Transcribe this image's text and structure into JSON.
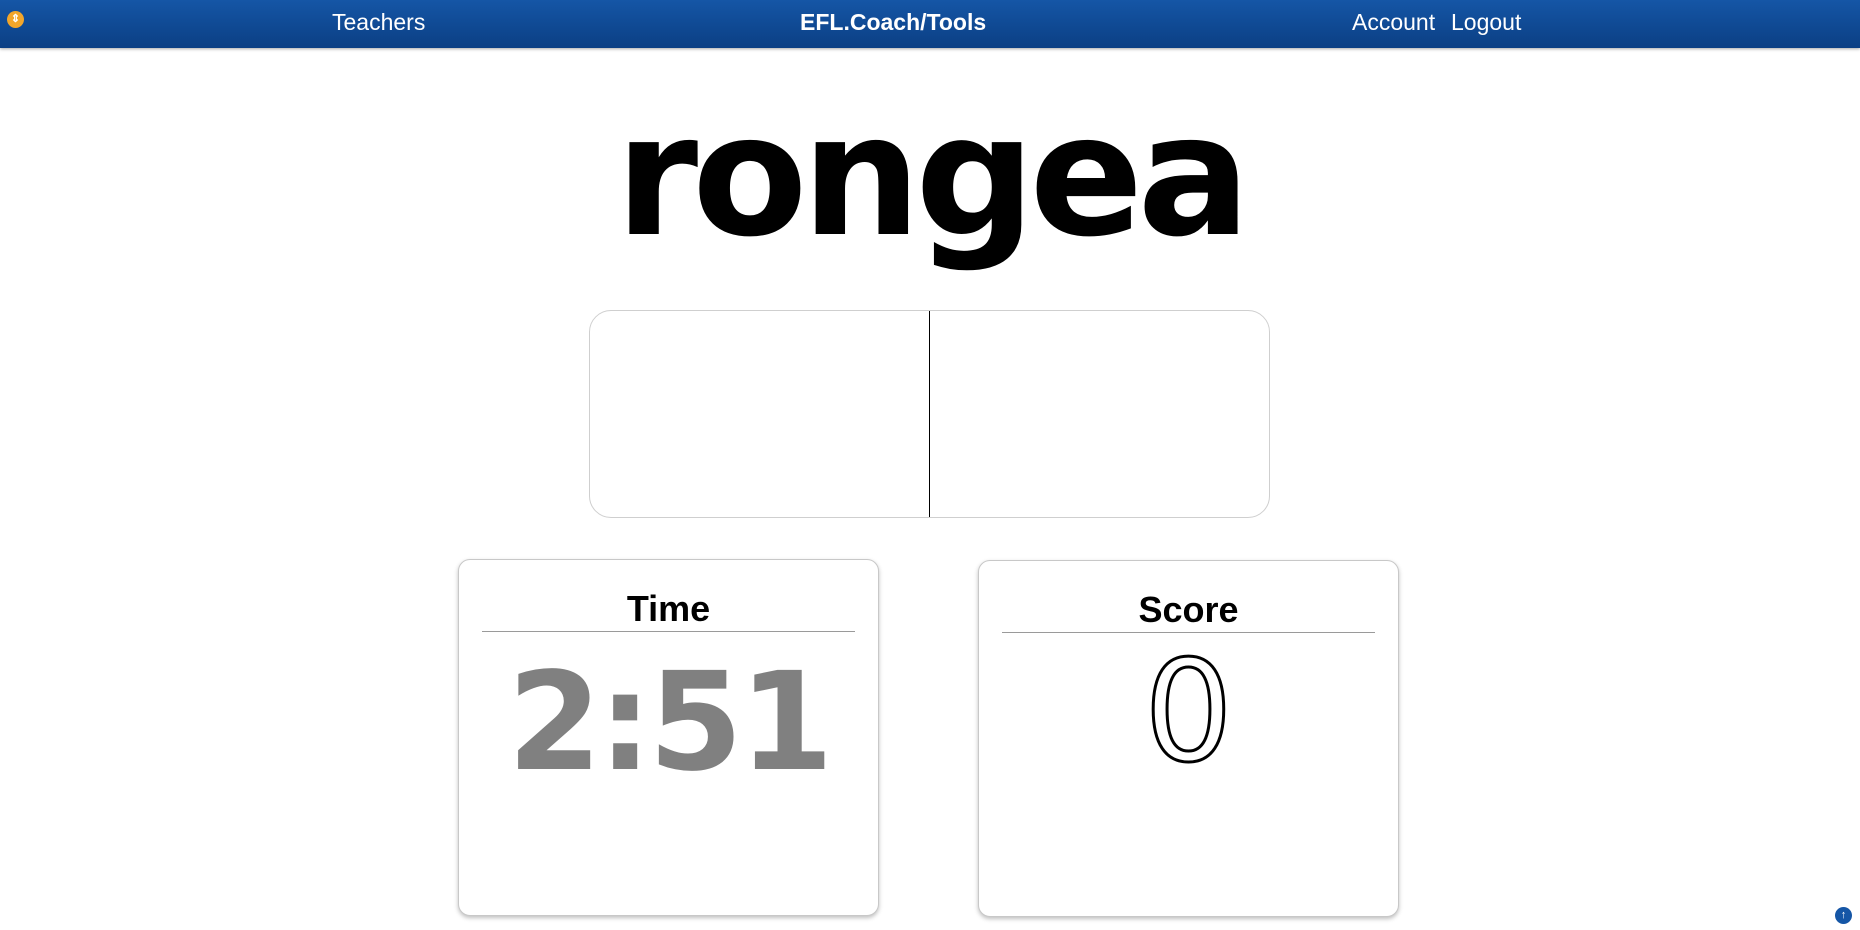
{
  "nav": {
    "teachers_label": "Teachers",
    "brand_label": "EFL.Coach/Tools",
    "account_label": "Account",
    "logout_label": "Logout"
  },
  "game": {
    "scrambled_word": "rongea",
    "answer_value": ""
  },
  "timer": {
    "title": "Time",
    "value": "2:51"
  },
  "score": {
    "title": "Score",
    "value": "0"
  },
  "colors": {
    "nav_bar": "#0b3f84",
    "menu_toggle": "#f2a62b",
    "timer_text": "#808080"
  },
  "icons": {
    "menu_toggle": "menu-toggle-icon",
    "scroll_top": "arrow-up-icon"
  }
}
